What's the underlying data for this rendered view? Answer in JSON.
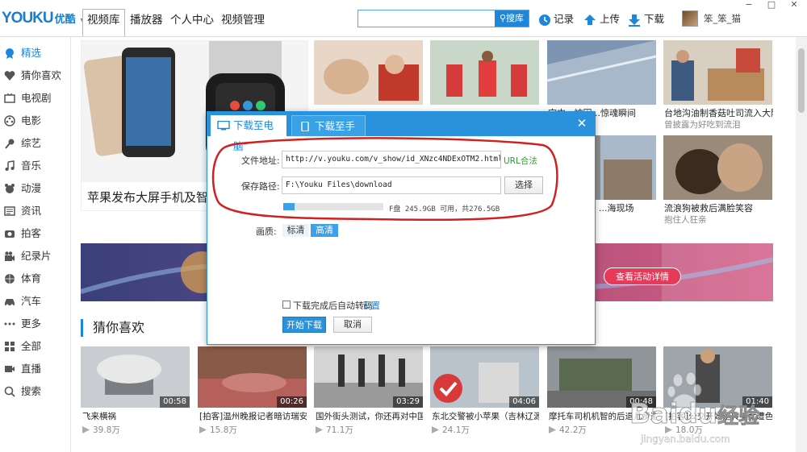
{
  "header": {
    "logo_text": "YOUKU",
    "logo_cn": "优酷",
    "tabs": [
      {
        "label": "视频库"
      },
      {
        "label": "播放器"
      },
      {
        "label": "个人中心"
      },
      {
        "label": "视频管理"
      }
    ],
    "search": {
      "placeholder": "",
      "button_label": "搜库"
    },
    "tools": [
      {
        "label": "记录",
        "icon": "clock-icon"
      },
      {
        "label": "上传",
        "icon": "upload-icon"
      },
      {
        "label": "下载",
        "icon": "download-icon"
      }
    ],
    "username": "笨_笨_猫",
    "window_controls": [
      "−",
      "□",
      "✕"
    ]
  },
  "sidebar": {
    "items": [
      {
        "label": "精选",
        "icon": "badge-icon"
      },
      {
        "label": "猜你喜欢",
        "icon": "heart-icon"
      },
      {
        "label": "电视剧",
        "icon": "tv-icon"
      },
      {
        "label": "电影",
        "icon": "film-reel-icon"
      },
      {
        "label": "综艺",
        "icon": "microphone-icon"
      },
      {
        "label": "音乐",
        "icon": "music-note-icon"
      },
      {
        "label": "动漫",
        "icon": "cartoon-icon"
      },
      {
        "label": "资讯",
        "icon": "news-icon"
      },
      {
        "label": "拍客",
        "icon": "camera-icon"
      },
      {
        "label": "纪录片",
        "icon": "documentary-icon"
      },
      {
        "label": "体育",
        "icon": "ball-icon"
      },
      {
        "label": "汽车",
        "icon": "car-icon"
      },
      {
        "label": "更多",
        "icon": "more-dots-icon"
      },
      {
        "label": "全部",
        "icon": "grid-icon"
      },
      {
        "label": "直播",
        "icon": "live-icon"
      },
      {
        "label": "搜索",
        "icon": "search-icon"
      }
    ]
  },
  "hero": {
    "caption": "苹果发布大屏手机及智能"
  },
  "top_cards": [
    {
      "title": "",
      "sub": ""
    },
    {
      "title": "",
      "sub": ""
    },
    {
      "title": "空中惊魂",
      "sub": "",
      "title_visible": "空中...被困...惊魂瞬间"
    },
    {
      "title": "台地沟油制香菇吐司流入大陆",
      "sub": "曾披露为好吃到流泪"
    },
    {
      "title": "",
      "sub": ""
    },
    {
      "title": "",
      "sub": ""
    },
    {
      "title": "...海现场",
      "sub": ""
    },
    {
      "title": "流浪狗被救后满脸笑容",
      "sub": "抱住人狂亲"
    }
  ],
  "banner": {
    "button_label": "查看活动详情"
  },
  "section": {
    "title": "猜你喜欢"
  },
  "videos": [
    {
      "title": "飞来横祸",
      "plays": "39.8万",
      "duration": "00:58"
    },
    {
      "title": "[拍客]温州晚报记者暗访瑞安",
      "plays": "15.8万",
      "duration": "00:26"
    },
    {
      "title": "国外街头测试，你还再对中国",
      "plays": "71.1万",
      "duration": "03:29"
    },
    {
      "title": "东北交警被小苹果（吉林辽源",
      "plays": "24.1万",
      "duration": "04:06"
    },
    {
      "title": "摩托车司机机智的后退几步避",
      "plays": "42.2万",
      "duration": "00:48"
    },
    {
      "title": "[拍客]公交开始逆转美女遭色",
      "plays": "18.0万",
      "duration": "01:40"
    }
  ],
  "dialog": {
    "tabs": [
      {
        "label": "下载至电脑",
        "icon": "monitor-icon"
      },
      {
        "label": "下载至手机",
        "icon": "phone-icon"
      }
    ],
    "close": "✕",
    "url_label": "文件地址:",
    "url_value": "http://v.youku.com/v_show/id_XNzc4NDExOTM2.html",
    "url_status": "URL合法",
    "path_label": "保存路径:",
    "path_value": "F:\\Youku Files\\download",
    "choose_label": "选择",
    "disk_info": "F盘  245.9GB 可用，共276.5GB",
    "disk_used_fraction": 0.11,
    "quality_label": "画质:",
    "quality_options": [
      {
        "label": "标清",
        "selected": false
      },
      {
        "label": "高清",
        "selected": true
      }
    ],
    "auto_convert_label": "下载完成后自动转码",
    "settings_link": "设置",
    "start_label": "开始下载",
    "cancel_label": "取消"
  },
  "watermark": {
    "brand": "Baidu",
    "brand_cn": "经验",
    "url": "jingyan.baidu.com"
  },
  "colors": {
    "accent": "#1e87d9",
    "annotation": "#d02020",
    "valid": "#2f9b2f"
  }
}
